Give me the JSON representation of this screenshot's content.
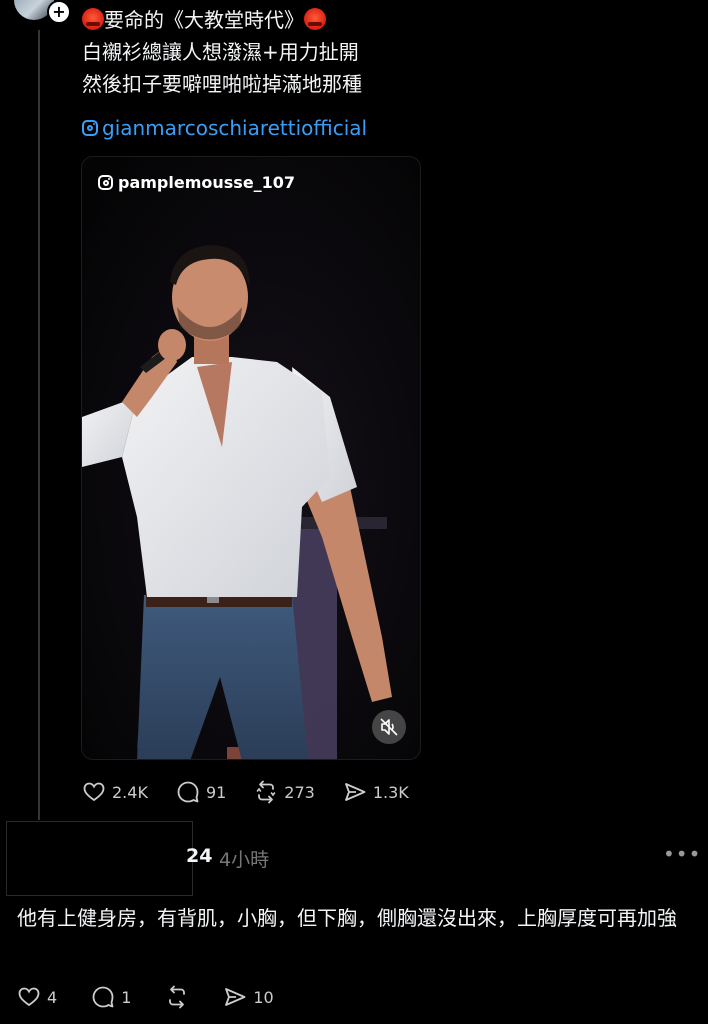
{
  "post": {
    "line1": "要命的《大教堂時代》",
    "line2": "白襯衫總讓人想潑濕+用力扯開",
    "line3": "然後扣子要噼哩啪啦掉滿地那種",
    "ig_link": "gianmarcoschiarettiofficial",
    "video_watermark": "pamplemousse_107",
    "stats": {
      "likes": "2.4K",
      "comments": "91",
      "reposts": "273",
      "shares": "1.3K"
    }
  },
  "reply": {
    "username_visible": "24",
    "time": "4小時",
    "text": "他有上健身房，有背肌，小胸，但下胸，側胸還沒出來，上胸厚度可再加強",
    "stats": {
      "likes": "4",
      "comments": "1",
      "shares": "10"
    }
  },
  "icons": {
    "follow": "plus-icon",
    "like": "heart-icon",
    "comment": "comment-bubble-icon",
    "repost": "repost-icon",
    "share": "send-icon",
    "mute": "speaker-muted-icon",
    "more": "more-dots-icon"
  },
  "colors": {
    "link": "#3b9ef6",
    "background": "#000000",
    "text": "#f3f5f7",
    "muted": "#777777"
  }
}
